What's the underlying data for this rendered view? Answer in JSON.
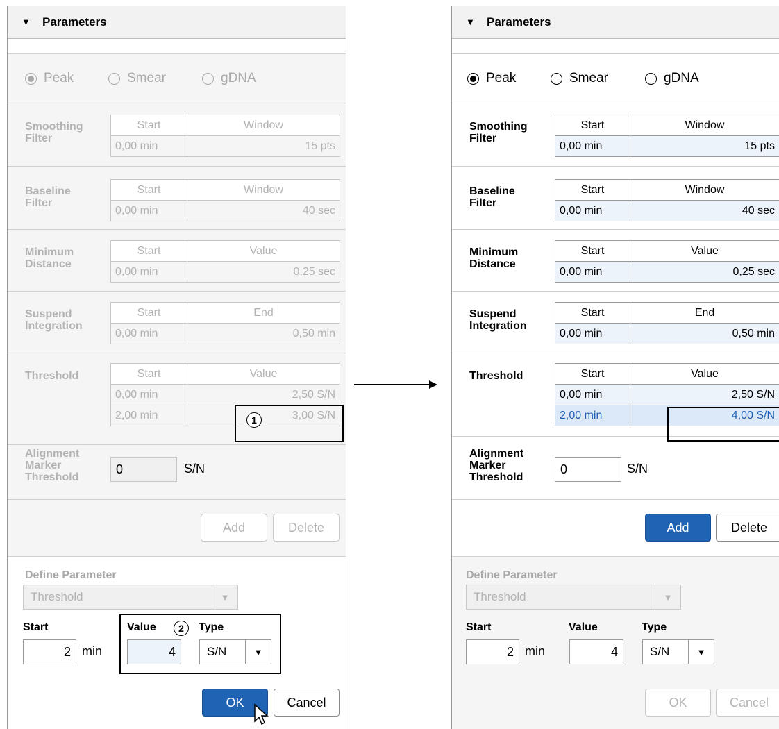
{
  "panel_title": "Parameters",
  "collapse_icon": "triangle-down-icon",
  "radios": [
    {
      "label": "Peak",
      "checked": true
    },
    {
      "label": "Smear",
      "checked": false
    },
    {
      "label": "gDNA",
      "checked": false
    }
  ],
  "table_sections": [
    {
      "label_line1": "Smoothing",
      "label_line2": "Filter",
      "col1": "Start",
      "col2": "Window",
      "row1": [
        "0,00 min",
        "15 pts"
      ]
    },
    {
      "label_line1": "Baseline",
      "label_line2": "Filter",
      "col1": "Start",
      "col2": "Window",
      "row1": [
        "0,00 min",
        "40 sec"
      ]
    },
    {
      "label_line1": "Minimum",
      "label_line2": "Distance",
      "col1": "Start",
      "col2": "Value",
      "row1": [
        "0,00 min",
        "0,25 sec"
      ]
    },
    {
      "label_line1": "Suspend",
      "label_line2": "Integration",
      "col1": "Start",
      "col2": "End",
      "row1": [
        "0,00 min",
        "0,50 min"
      ]
    },
    {
      "label_line1": "Threshold",
      "label_line2": "",
      "col1": "Start",
      "col2": "Value",
      "row1": [
        "0,00 min",
        "2,50 S/N"
      ]
    }
  ],
  "threshold_row2": {
    "before": [
      "2,00 min",
      "3,00 S/N"
    ],
    "after": [
      "2,00 min",
      "4,00 S/N"
    ]
  },
  "alignment": {
    "line1": "Alignment",
    "line2": "Marker",
    "line3": "Threshold",
    "value": "0",
    "unit": "S/N"
  },
  "buttons": {
    "add": "Add",
    "delete": "Delete",
    "ok": "OK",
    "cancel": "Cancel"
  },
  "define": {
    "title": "Define Parameter",
    "selected": "Threshold",
    "start_label": "Start",
    "start_value": "2",
    "start_unit": "min",
    "value_label": "Value",
    "value_value": "4",
    "type_label": "Type",
    "type_value": "S/N"
  },
  "callouts": [
    "1",
    "2"
  ],
  "colors": {
    "primary": "#1f63b5",
    "selected_text": "#1f5fb5",
    "cell_bg": "#edf3fb"
  }
}
